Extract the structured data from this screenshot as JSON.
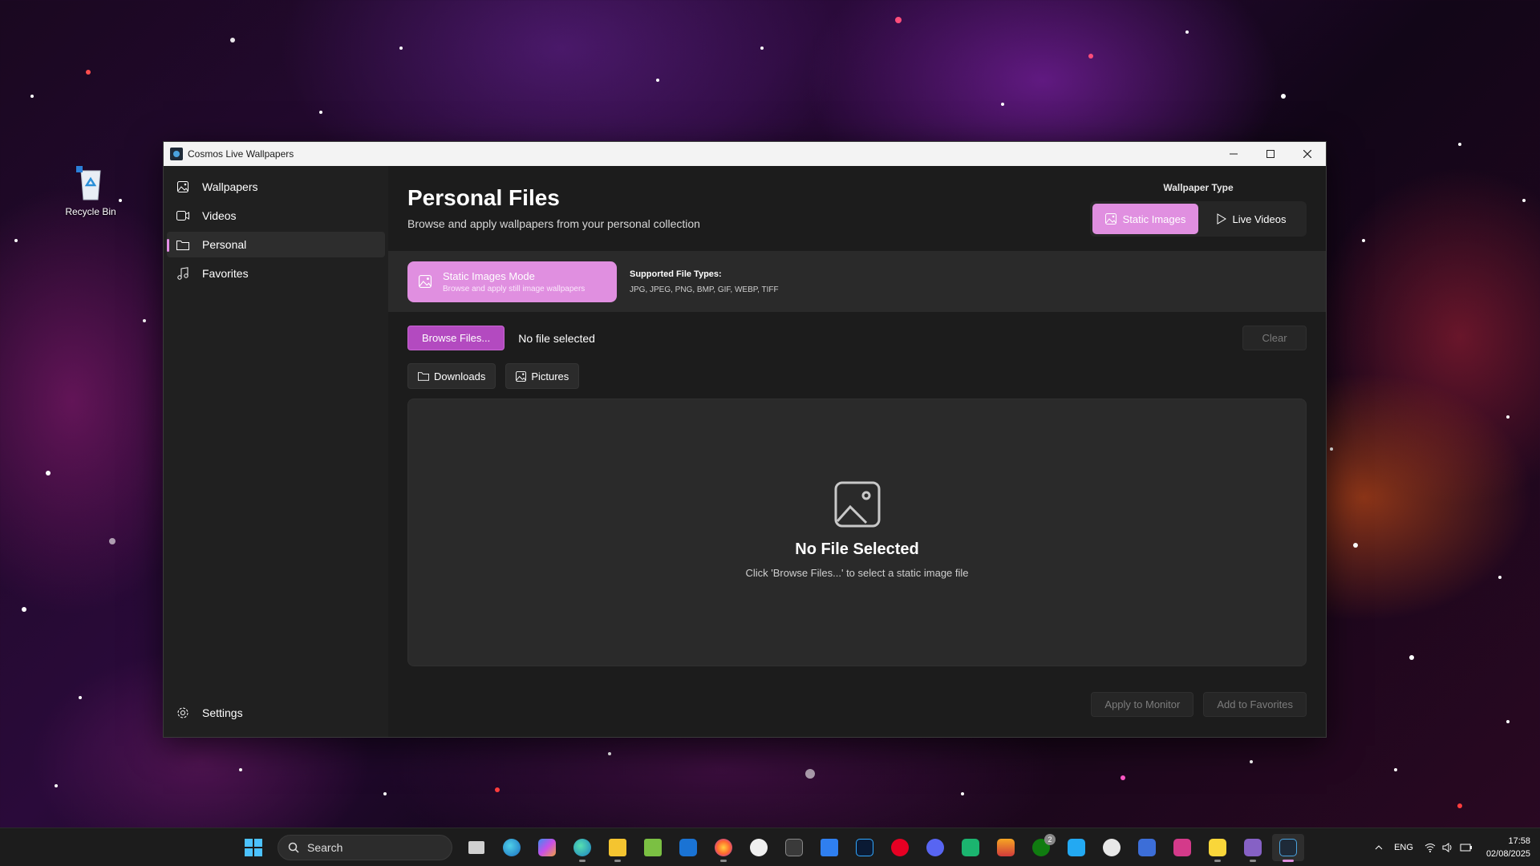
{
  "desktop": {
    "recycle_bin_label": "Recycle Bin"
  },
  "window": {
    "title": "Cosmos Live Wallpapers"
  },
  "sidebar": {
    "items": [
      {
        "label": "Wallpapers",
        "icon": "image-icon"
      },
      {
        "label": "Videos",
        "icon": "video-icon"
      },
      {
        "label": "Personal",
        "icon": "folder-icon",
        "active": true
      },
      {
        "label": "Favorites",
        "icon": "music-note-icon"
      }
    ],
    "settings_label": "Settings"
  },
  "header": {
    "title": "Personal Files",
    "subtitle": "Browse and apply wallpapers from your personal collection"
  },
  "wallpaper_type": {
    "label": "Wallpaper Type",
    "options": [
      "Static Images",
      "Live Videos"
    ],
    "selected": "Static Images"
  },
  "mode": {
    "title": "Static Images Mode",
    "subtitle": "Browse and apply still image wallpapers",
    "supported_label": "Supported File Types:",
    "supported_types": "JPG, JPEG, PNG, BMP, GIF, WEBP, TIFF"
  },
  "file": {
    "browse_label": "Browse Files...",
    "status": "No file selected",
    "clear_label": "Clear",
    "quick_folders": [
      "Downloads",
      "Pictures"
    ]
  },
  "preview": {
    "heading": "No File Selected",
    "hint": "Click 'Browse Files...' to select a static image file"
  },
  "actions": {
    "apply_label": "Apply to Monitor",
    "favorite_label": "Add to Favorites"
  },
  "taskbar": {
    "search_placeholder": "Search",
    "language": "ENG",
    "time": "17:58",
    "date": "02/08/2025",
    "xbox_badge": "2"
  },
  "colors": {
    "accent": "#e08fe0",
    "primary_button": "#b34ac0",
    "window_bg": "#202020",
    "panel_bg": "#2a2a2a"
  }
}
